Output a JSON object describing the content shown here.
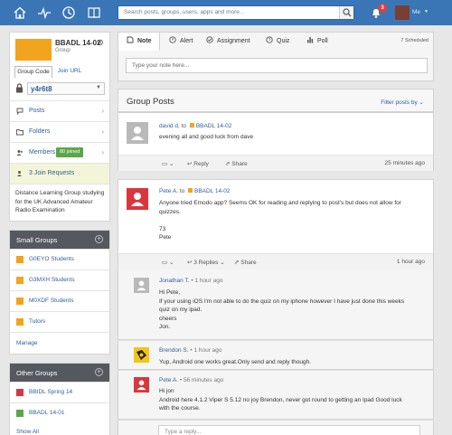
{
  "colors": {
    "topbar": "#3a76b6",
    "accent_blue": "#2f5f9a",
    "group_orange": "#f2a41e",
    "green_badge": "#5aa74a",
    "red_avatar": "#d9363e",
    "dark_header": "#55585e"
  },
  "topbar": {
    "nav_icons": [
      "home-icon",
      "pulse-icon",
      "backpack-icon",
      "book-icon"
    ],
    "search_placeholder": "Search posts, groups, users, apps and more...",
    "notification_count": "3",
    "me_label": "Me"
  },
  "group": {
    "name": "BBADL 14-02",
    "type": "Group",
    "tabs": [
      "Group Code",
      "Join URL"
    ],
    "code": "y4r6t8",
    "nav": [
      {
        "label": "Posts",
        "icon": "speech-bubble-icon"
      },
      {
        "label": "Folders",
        "icon": "folder-icon"
      },
      {
        "label": "Members",
        "icon": "people-icon",
        "badge": "80 joined"
      },
      {
        "label": "3 Join Requests",
        "icon": "user-add-icon"
      }
    ],
    "description": "Distance Learning Group studying for the UK Advanced Amateur Radio Examination"
  },
  "small_groups": {
    "title": "Small Groups",
    "items": [
      {
        "label": "G0EYO Students",
        "color": "#f2a41e"
      },
      {
        "label": "G3MXH Students",
        "color": "#f2a41e"
      },
      {
        "label": "M0XDF Students",
        "color": "#f2a41e"
      },
      {
        "label": "Tutors",
        "color": "#f2a41e"
      }
    ],
    "manage": "Manage"
  },
  "other_groups": {
    "title": "Other Groups",
    "items": [
      {
        "label": "BBIDL Spring 14",
        "color": "#d9363e"
      },
      {
        "label": "BBADL 14-01",
        "color": "#5aa74a"
      }
    ],
    "show_all": "Show All"
  },
  "composer": {
    "tabs": [
      {
        "label": "Note",
        "icon": "note-icon"
      },
      {
        "label": "Alert",
        "icon": "alert-icon"
      },
      {
        "label": "Assignment",
        "icon": "check-circle-icon"
      },
      {
        "label": "Quiz",
        "icon": "question-icon"
      },
      {
        "label": "Poll",
        "icon": "bar-chart-icon"
      }
    ],
    "scheduled": "7 Scheduled",
    "placeholder": "Type your note here..."
  },
  "posts_header": {
    "title": "Group Posts",
    "filter": "Filter posts by"
  },
  "posts": [
    {
      "author": "david d.",
      "to": "to",
      "group": "BBADL 14-02",
      "body": [
        "evening all and good luck from dave"
      ],
      "actions": {
        "reply": "Reply",
        "share": "Share"
      },
      "time": "25 minutes ago"
    },
    {
      "author": "Pete A.",
      "to": "to",
      "group": "BBADL 14-02",
      "body": [
        "Anyone tried Emodo app? Seems OK for reading and replying to post's but does not allow for",
        "quizzes.",
        "",
        "73",
        "Pete"
      ],
      "actions": {
        "replies": "3 Replies",
        "share": "Share"
      },
      "time": "1 hour ago"
    }
  ],
  "replies": [
    {
      "author": "Jonathan T.",
      "time": "1 hour ago",
      "body": [
        "Hi Pete,",
        "If your using iOS I'm not able to do the quiz on my iphone however I have just done this weeks",
        "quiz on my ipad.",
        "cheers",
        "Jon."
      ]
    },
    {
      "author": "Brendon S.",
      "time": "1 hour ago",
      "body": [
        "Yup, Android one works great.Only send and reply though."
      ]
    },
    {
      "author": "Pete A.",
      "time": "56 minutes ago",
      "body": [
        "Hi jon",
        "Android here 4.1.2 Viper S 5.12 no joy Brendon, never got round to getting an Ipad Good luck",
        "with the course."
      ]
    }
  ],
  "reply_placeholder": "Type a reply..."
}
